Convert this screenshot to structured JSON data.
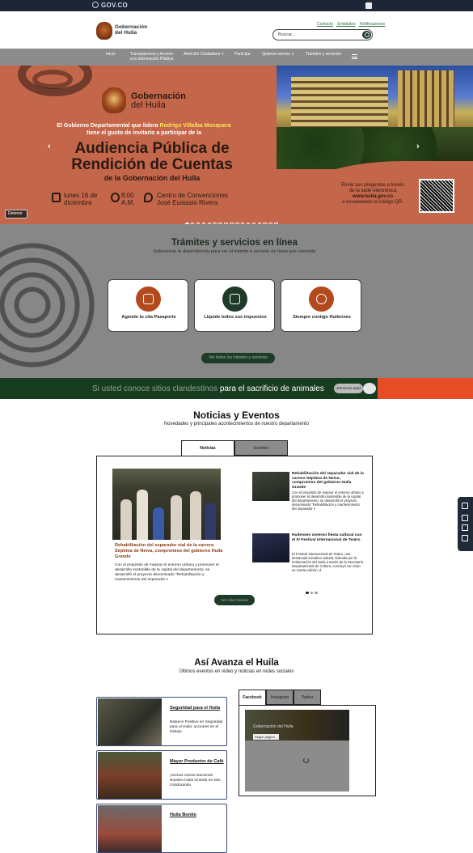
{
  "govbar": {
    "label": "GOV.CO"
  },
  "header": {
    "logo_line1": "Gobernación",
    "logo_line2": "del Huila",
    "top_links": [
      "Contacto",
      "Entidades",
      "Notificaciones"
    ],
    "search_placeholder": "Buscar..."
  },
  "nav": {
    "items": [
      {
        "label": "Inicio"
      },
      {
        "label": "Transparencia y Acceso a la Información Pública"
      },
      {
        "label": "Atención Ciudadana ∨"
      },
      {
        "label": "Participa"
      },
      {
        "label": "Quienes somos ∨"
      },
      {
        "label": "Trámites y servicios"
      }
    ]
  },
  "hero": {
    "logo_line1": "Gobernación",
    "logo_line2": "del Huila",
    "intro_a": "El Gobierno Departamental que lidera ",
    "intro_name": "Rodrigo Villalba Mosquera",
    "intro_b": "tiene el gusto de invitarlo a participar de la",
    "title_line1": "Audiencia Pública de",
    "title_line2": "Rendición de Cuentas",
    "subtitle": "de la Gobernación del Huila",
    "date_line1": "lunes 16 de",
    "date_line2": "diciembre",
    "time_line1": "8:00",
    "time_line2": "A.M.",
    "place_line1": "Centro de Convenciones",
    "place_line2": "José Eustasio Rivera",
    "side_line1": "Envíe sus preguntas a través",
    "side_line2": "de la sede electrónica",
    "side_url": "www.huila.gov.co",
    "side_line3": "o escaneando el código QR.",
    "pause_label": "Detener",
    "slide_count": 17,
    "active_slide": 0
  },
  "tramites": {
    "title": "Trámites y servicios en línea",
    "description": "Seleccione la dependencia para ver el trámite o servicio en línea que necesita",
    "cards": [
      {
        "label": "Agende tu cita Pasaporte",
        "icon": "passport-icon",
        "color": "#b24a1e"
      },
      {
        "label": "Liquide todos sus impuestos",
        "icon": "tax-icon",
        "color": "#1e3b2a"
      },
      {
        "label": "Siempre contigo Huilenses",
        "icon": "handshake-icon",
        "color": "#b24a1e"
      }
    ],
    "all_button": "Ver todos los trámites y servicios"
  },
  "banner": {
    "text_dim": "Si usted conoce sitios clandestinos",
    "text_bright": " para el sacrificio de animales",
    "button": "¡Denuncia aquí!",
    "icon": "pig-icon"
  },
  "news": {
    "title": "Noticias y Eventos",
    "subtitle": "Novedades y principales acontecimientos de nuestro departamento",
    "tabs": [
      {
        "label": "Noticias"
      },
      {
        "label": "Eventos"
      }
    ],
    "active_tab": 0,
    "featured": {
      "title": "Rehabilitación del separador vial de la carrera Séptima de Neiva, compromiso del gobierno Huila Grande",
      "text": "Con el propósito de mejorar el entorno urbano y promover el desarrollo sostenible de la capital del departamento, se desarrolló el proyecto denominado \"Rehabilitación y mantenimiento del separador v"
    },
    "items": [
      {
        "title": "Rehabilitación del separador vial de la carrera Séptima de Neiva, compromiso del gobierno Huila Grande",
        "text": "Con el propósito de mejorar el entorno urbano y promover el desarrollo sostenible de la capital del departamento, se desarrolló el proyecto denominado \"Rehabilitación y mantenimiento del separador v"
      },
      {
        "title": "Huilenses vivieron fiesta cultural con el IV Festival Internacional de Teatro",
        "text": "El Festival Internacional de Teatro, una destacada iniciativa cultural, liderada por la Gobernación del Huila a través de la Secretaría Departamental de Cultura, concluyó con éxito su cuarta edición, d"
      }
    ],
    "pages": 3,
    "active_page": 0,
    "more_button": "Ver más noticias"
  },
  "avanza": {
    "title": "Así Avanza el Huila",
    "subtitle": "Últimos eventos en video y noticias en redes sociales",
    "videos": [
      {
        "title": "Seguridad para el Huila",
        "text": "Balance Positivo en Seguridad para el Huila: acciones en el trabajo"
      },
      {
        "title": "Mayor Productor de Café",
        "text": "¡Somos noticia Nacional! Nuestro Huila Grande es sitio cosidorando"
      },
      {
        "title": "Huila Bonito",
        "text": ""
      }
    ],
    "social_tabs": [
      {
        "label": "Facebook"
      },
      {
        "label": "Instagram"
      },
      {
        "label": "Twitter"
      }
    ],
    "active_social": 0,
    "fb_page_name": "Gobernación del Huila",
    "fb_follow": "Seguir página"
  },
  "colors": {
    "dark_green": "#1e3b2a",
    "terracotta": "#c4664a",
    "navy": "#1d2636",
    "orange_red": "#e84e26"
  }
}
